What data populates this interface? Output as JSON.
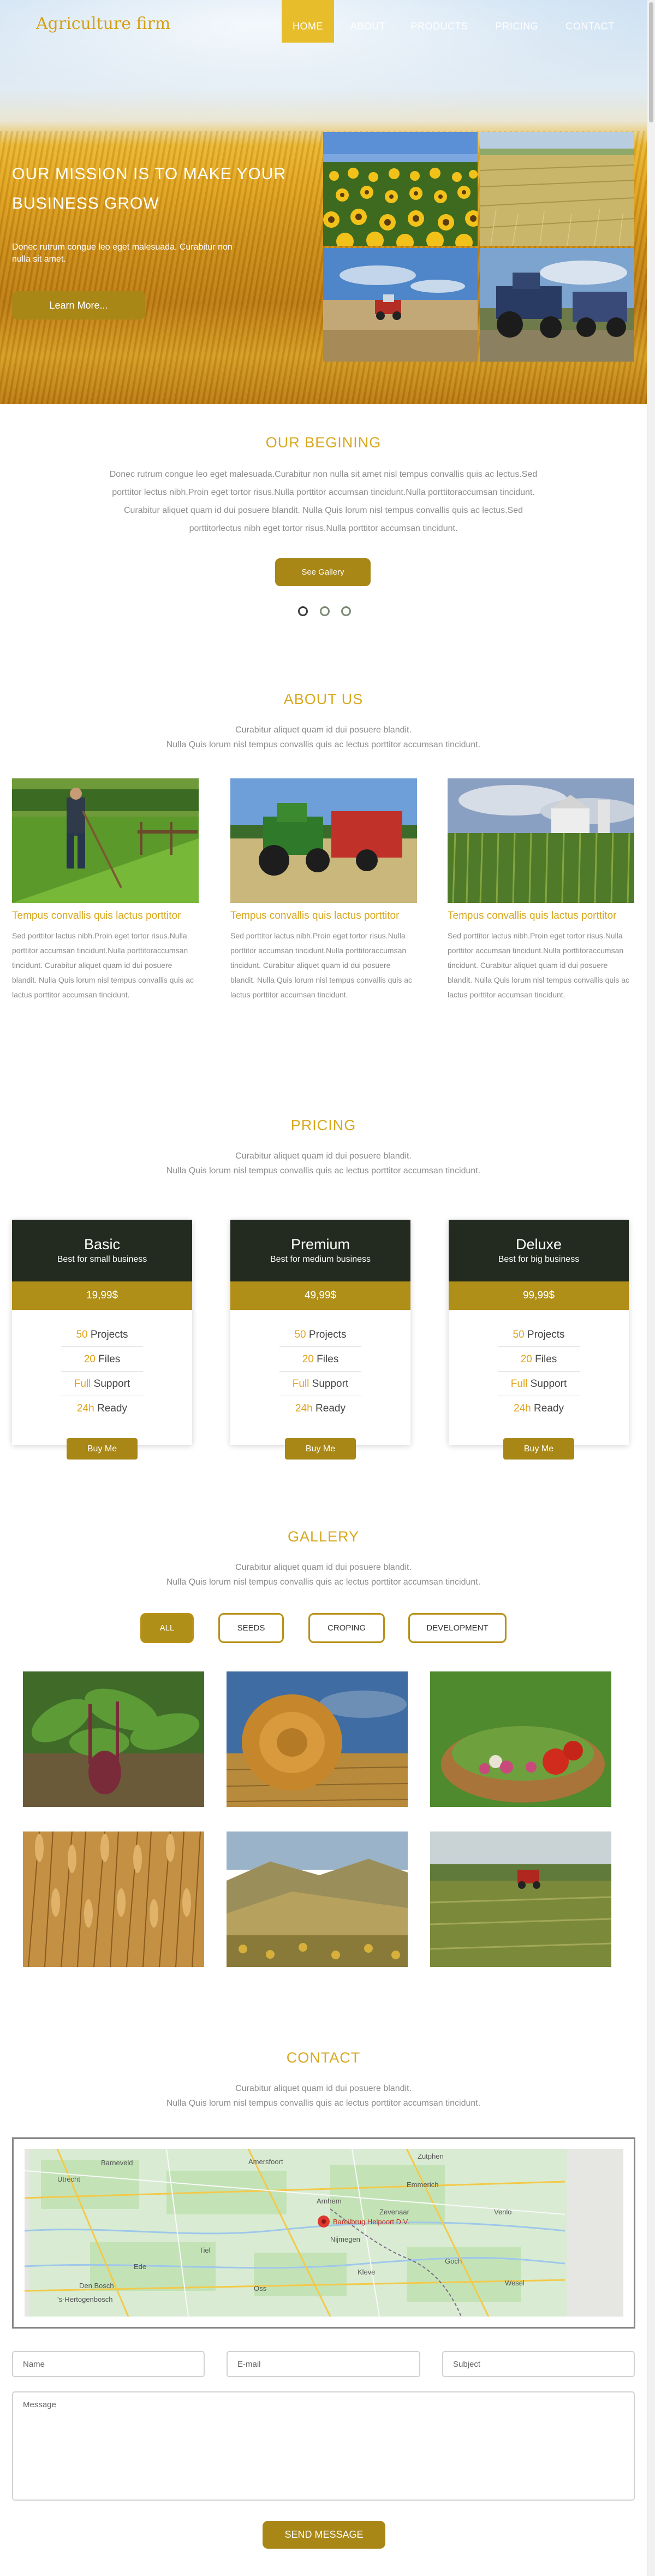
{
  "brand": "Agriculture firm",
  "nav": [
    "HOME",
    "ABOUT",
    "PRODUCTS",
    "PRICING",
    "CONTACT"
  ],
  "hero": {
    "title": "OUR MISSION IS TO MAKE YOUR BUSINESS GROW",
    "text": "Donec rutrum congue leo eget malesuada. Curabitur non nulla sit amet.",
    "button": "Learn More..."
  },
  "begining": {
    "title": "OUR BEGINING",
    "text": "Donec rutrum congue leo eget malesuada.Curabitur non nulla sit amet nisl tempus convallis quis ac lectus.Sed porttitor lectus nibh.Proin eget tortor risus.Nulla porttitor accumsan tincidunt.Nulla porttitoraccumsan tincidunt. Curabitur aliquet quam id dui posuere blandit. Nulla Quis lorum nisl tempus convallis quis ac lectus.Sed porttitorlectus nibh eget tortor risus.Nulla porttitor accumsan tincidunt.",
    "button": "See Gallery"
  },
  "about": {
    "title": "ABOUT US",
    "sub1": "Curabitur aliquet quam id dui posuere blandit.",
    "sub2": "Nulla Quis lorum nisl tempus convallis quis ac lectus porttitor accumsan tincidunt.",
    "cards": [
      {
        "heading": "Tempus convallis quis lactus porttitor",
        "body": "Sed porttitor lactus nibh.Proin eget tortor risus.Nulla porttitor accumsan tincidunt.Nulla porttitoraccumsan tincidunt. Curabitur aliquet quam id dui posuere blandit. Nulla Quis lorum nisl tempus convallis quis ac lactus porttitor accumsan tincidunt."
      },
      {
        "heading": "Tempus convallis quis lactus porttitor",
        "body": "Sed porttitor lactus nibh.Proin eget tortor risus.Nulla porttitor accumsan tincidunt.Nulla porttitoraccumsan tincidunt. Curabitur aliquet quam id dui posuere blandit. Nulla Quis lorum nisl tempus convallis quis ac lactus porttitor accumsan tincidunt."
      },
      {
        "heading": "Tempus convallis quis lactus porttitor",
        "body": "Sed porttitor lactus nibh.Proin eget tortor risus.Nulla porttitor accumsan tincidunt.Nulla porttitoraccumsan tincidunt. Curabitur aliquet quam id dui posuere blandit. Nulla Quis lorum nisl tempus convallis quis ac lactus porttitor accumsan tincidunt."
      }
    ]
  },
  "pricing": {
    "title": "PRICING",
    "sub1": "Curabitur aliquet quam id dui posuere blandit.",
    "sub2": "Nulla Quis lorum nisl tempus convallis quis ac lectus porttitor accumsan tincidunt.",
    "plans": [
      {
        "name": "Basic",
        "desc": "Best for small business",
        "price": "19,99$",
        "f1n": "50",
        "f1": "Projects",
        "f2n": "20",
        "f2": "Files",
        "f3n": "Full",
        "f3": "Support",
        "f4n": "24h",
        "f4": "Ready",
        "button": "Buy Me"
      },
      {
        "name": "Premium",
        "desc": "Best for medium business",
        "price": "49,99$",
        "f1n": "50",
        "f1": "Projects",
        "f2n": "20",
        "f2": "Files",
        "f3n": "Full",
        "f3": "Support",
        "f4n": "24h",
        "f4": "Ready",
        "button": "Buy Me"
      },
      {
        "name": "Deluxe",
        "desc": "Best for big business",
        "price": "99,99$",
        "f1n": "50",
        "f1": "Projects",
        "f2n": "20",
        "f2": "Files",
        "f3n": "Full",
        "f3": "Support",
        "f4n": "24h",
        "f4": "Ready",
        "button": "Buy Me"
      }
    ]
  },
  "gallery": {
    "title": "GALLERY",
    "sub1": "Curabitur aliquet quam id dui posuere blandit.",
    "sub2": "Nulla Quis lorum nisl tempus convallis quis ac lectus porttitor accumsan tincidunt.",
    "filters": [
      "ALL",
      "SEEDS",
      "CROPING",
      "DEVELOPMENT"
    ]
  },
  "contact": {
    "title": "CONTACT",
    "sub1": "Curabitur aliquet quam id dui posuere blandit.",
    "sub2": "Nulla Quis lorum nisl tempus convallis quis ac lectus porttitor accumsan tincidunt.",
    "map": {
      "pin_label": "Bareilbrug Helpoort D.V.",
      "places": [
        "Utrecht",
        "Amersfoort",
        "Barneveld",
        "Zutphen",
        "Arnhem",
        "Nijmegen",
        "Ede",
        "Tiel",
        "Den Bosch",
        "'s-Hertogenbosch",
        "Kleve",
        "Goch",
        "Venlo",
        "Oss",
        "Emmerich",
        "Zevenaar",
        "Wesel"
      ]
    },
    "name_placeholder": "Name",
    "email_placeholder": "E-mail",
    "subject_placeholder": "Subject",
    "message_placeholder": "Message",
    "send": "SEND MESSAGE"
  },
  "colors": {
    "accent": "#d8a81f",
    "button": "#a88717",
    "dark": "#232a1f"
  }
}
